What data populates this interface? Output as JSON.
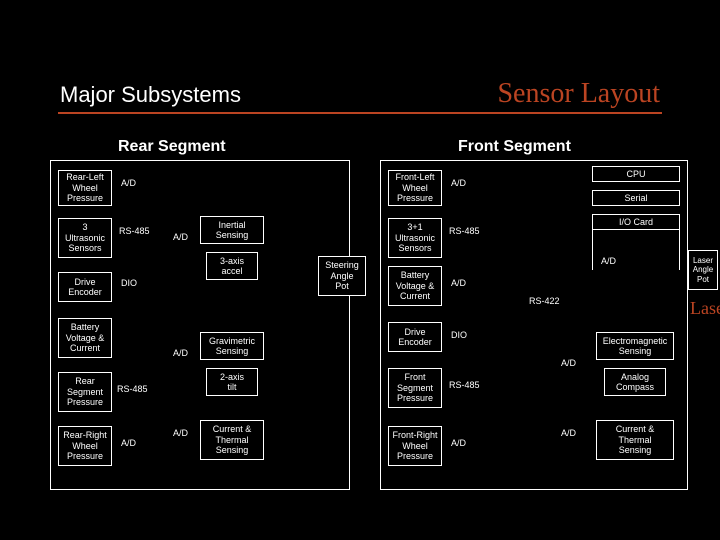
{
  "titles": {
    "left": "Major Subsystems",
    "right": "Sensor Layout",
    "rear": "Rear Segment",
    "front": "Front Segment"
  },
  "rear": {
    "rl_wheel": "Rear-Left\nWheel\nPressure",
    "ultra": "3\nUltrasonic\nSensors",
    "drive_enc": "Drive\nEncoder",
    "bvc": "Battery\nVoltage &\nCurrent",
    "seg_press": "Rear\nSegment\nPressure",
    "rr_wheel": "Rear-Right\nWheel\nPressure",
    "inertial": "Inertial\nSensing",
    "accel": "3-axis\naccel",
    "grav": "Gravimetric\nSensing",
    "tilt": "2-axis\ntilt",
    "cts": "Current &\nThermal\nSensing",
    "steering": "Steering\nAngle\nPot"
  },
  "front": {
    "fl_wheel": "Front-Left\nWheel\nPressure",
    "ultra": "3+1\nUltrasonic\nSensors",
    "bvc": "Battery\nVoltage &\nCurrent",
    "drive_enc": "Drive\nEncoder",
    "seg_press": "Front\nSegment\nPressure",
    "fr_wheel": "Front-Right\nWheel\nPressure",
    "cpu": "CPU",
    "serial": "Serial",
    "iocard": "I/O Card",
    "em": "Electromagnetic\nSensing",
    "compass": "Analog\nCompass",
    "cts": "Current &\nThermal\nSensing",
    "laser_pot": "Laser Angle\nPot"
  },
  "bus": {
    "ad": "A/D",
    "rs485": "RS-485",
    "dio": "DIO",
    "rs422": "RS-422"
  },
  "laser": "Laser"
}
